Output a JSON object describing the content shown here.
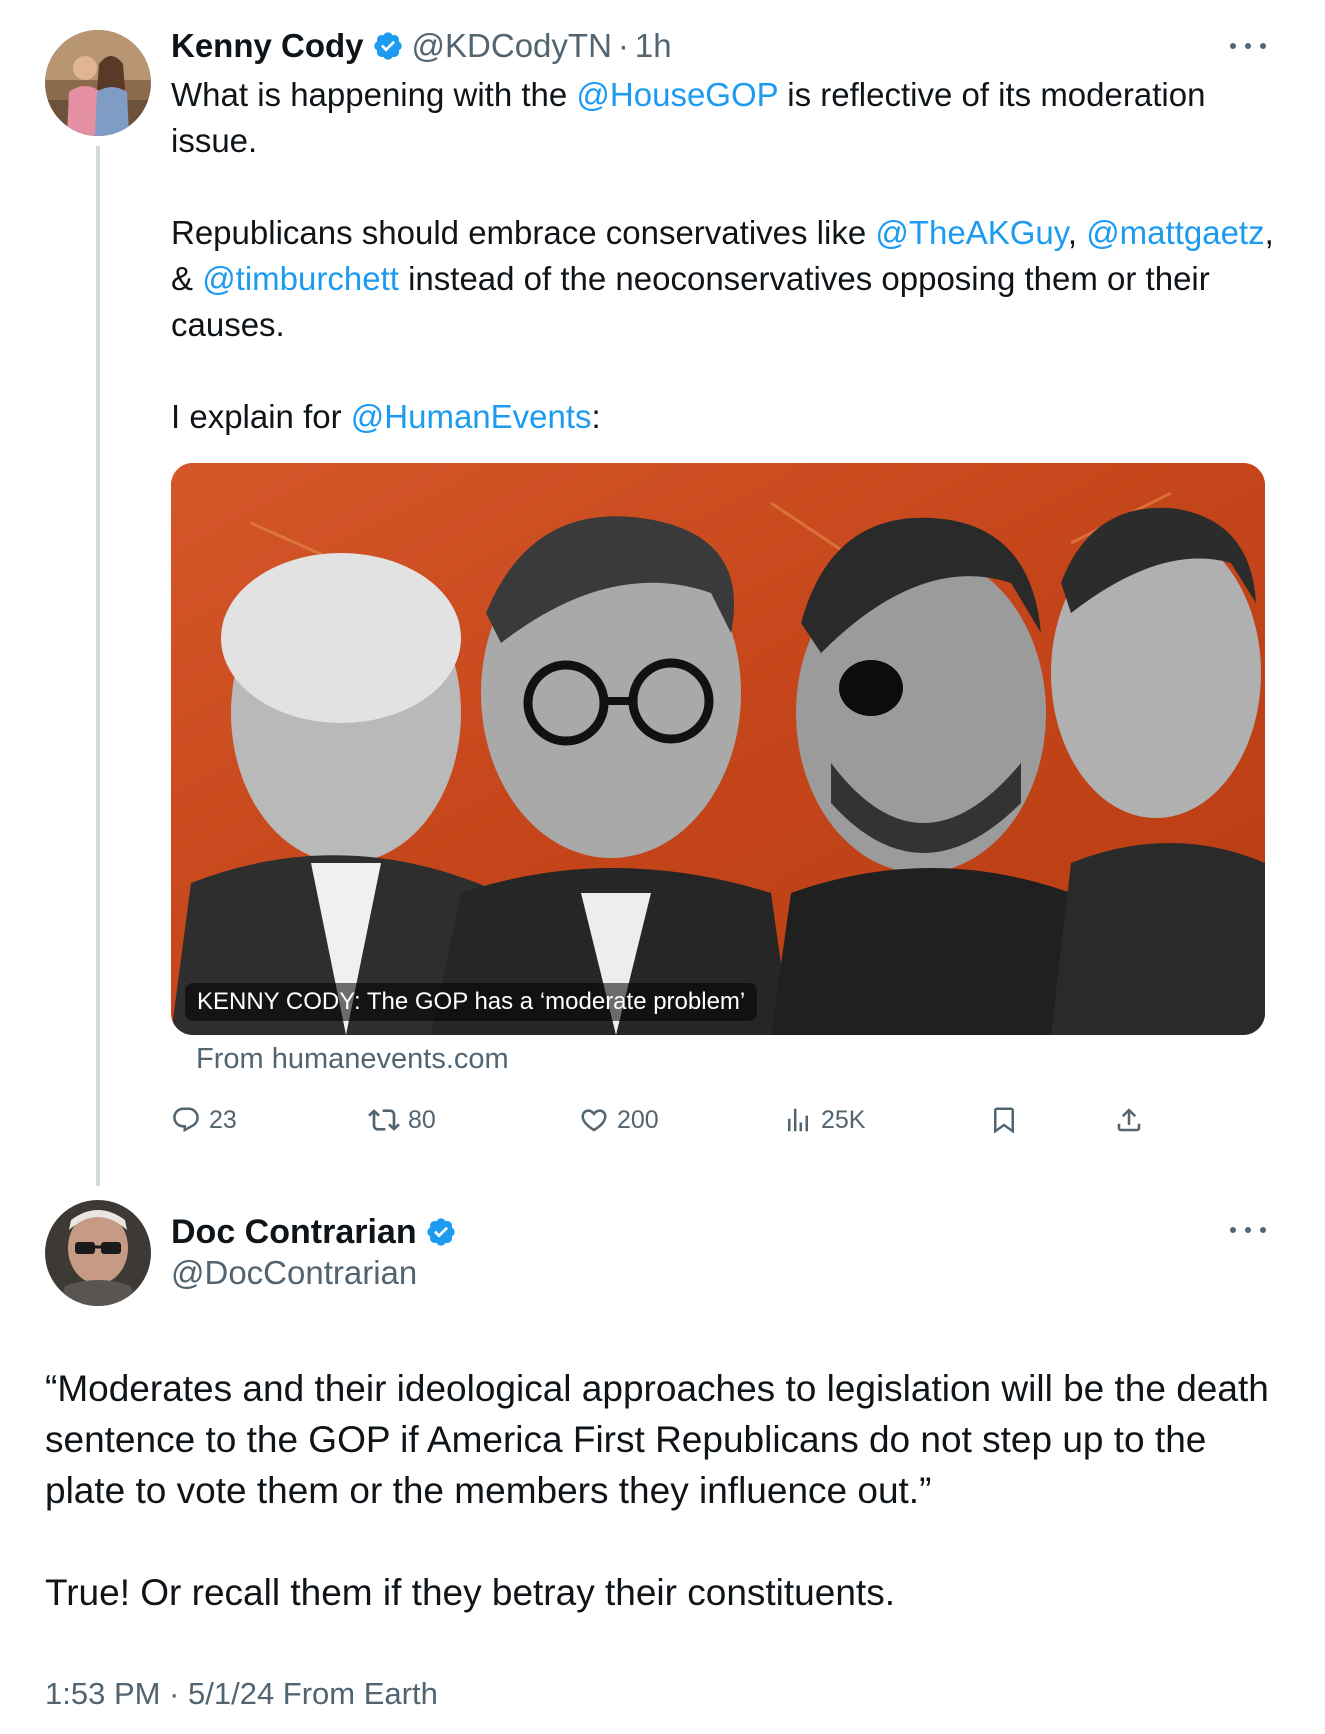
{
  "parent_tweet": {
    "author_name": "Kenny Cody",
    "author_handle": "@KDCodyTN",
    "separator": "·",
    "time_ago": "1h",
    "avatar_icon": "user-avatar-photo",
    "verified_icon": "verified-badge-icon",
    "text": {
      "line1_prefix": "What is happening with the ",
      "line1_mention": "@HouseGOP",
      "line1_suffix": " is reflective of its moderation issue.",
      "para2_prefix": "Republicans should embrace conservatives like ",
      "para2_mention1": "@TheAKGuy",
      "para2_comma": ", ",
      "para2_mention2": "@mattgaetz",
      "para2_amp": ", & ",
      "para2_mention3": "@timburchett",
      "para2_suffix": " instead of the neoconservatives opposing them or their causes.",
      "para3_prefix": "I explain for ",
      "para3_mention": "@HumanEvents",
      "para3_suffix": ":"
    },
    "link_card": {
      "caption": "KENNY CODY: The GOP has a ‘moderate problem’",
      "source": "From humanevents.com",
      "background_color": "#c94a1f"
    },
    "actions": {
      "replies": "23",
      "retweets": "80",
      "likes": "200",
      "views": "25K"
    }
  },
  "main_tweet": {
    "author_name": "Doc Contrarian",
    "author_handle": "@DocContrarian",
    "avatar_icon": "user-avatar-photo",
    "verified_icon": "verified-badge-icon",
    "text": {
      "para1": "“Moderates and their ideological approaches to legislation will be the death sentence to the GOP if America First Republicans do not step up to the plate to vote them or the members they influence out.”",
      "para2": "True! Or recall them if they betray their constituents."
    },
    "meta": "1:53 PM · 5/1/24 From Earth"
  },
  "colors": {
    "link": "#1d9bf0",
    "muted": "#536471",
    "thread_line": "#cfd9de",
    "verified": "#1d9bf0"
  }
}
